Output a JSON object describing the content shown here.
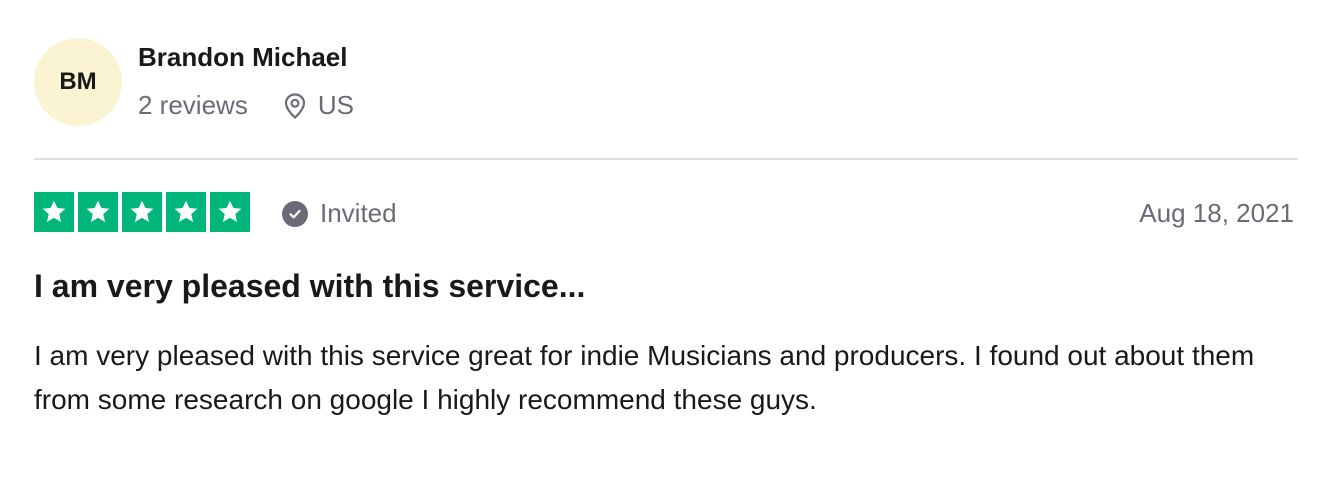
{
  "reviewer": {
    "initials": "BM",
    "name": "Brandon Michael",
    "reviews_count": "2 reviews",
    "location": "US"
  },
  "review": {
    "stars": 5,
    "max_stars": 5,
    "status": "Invited",
    "date": "Aug 18, 2021",
    "title": "I am very pleased with this service...",
    "text": "I am very pleased with this service great for indie Musicians and producers. I found out about them from some research on google I highly recommend these guys."
  },
  "icons": {
    "star": "star-icon",
    "location": "map-pin-icon",
    "verified": "check-circle-icon"
  },
  "colors": {
    "star_background": "#00b67a",
    "avatar_background": "#faf4d3",
    "muted_text": "#6b6b78"
  }
}
